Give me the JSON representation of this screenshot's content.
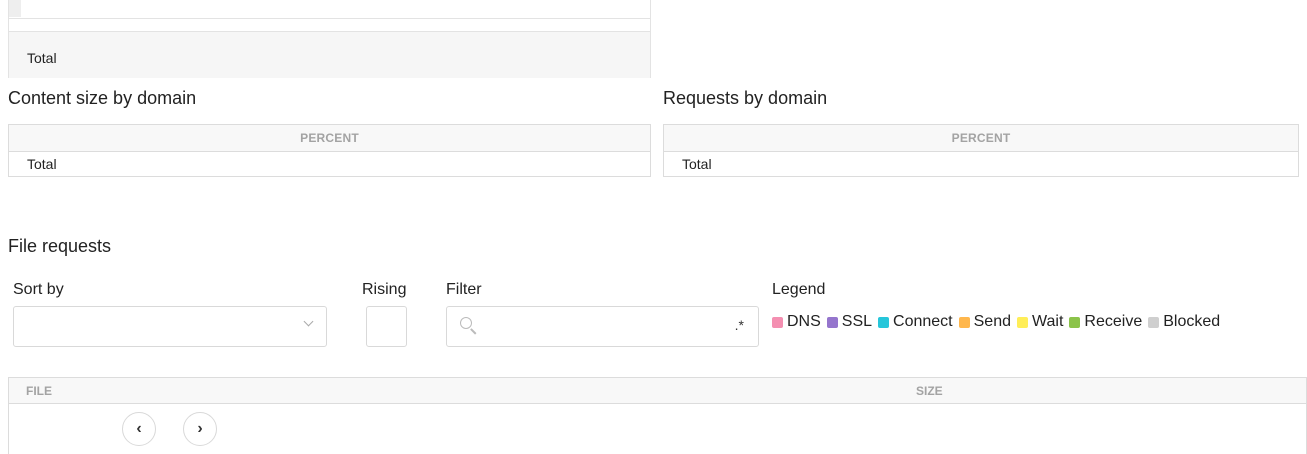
{
  "top_table": {
    "total_label": "Total"
  },
  "content_size": {
    "title": "Content size by domain",
    "column_header": "PERCENT",
    "total_label": "Total"
  },
  "requests": {
    "title": "Requests by domain",
    "column_header": "PERCENT",
    "total_label": "Total"
  },
  "file_requests": {
    "title": "File requests",
    "sort_by_label": "Sort by",
    "sort_by_value": "",
    "rising_label": "Rising",
    "filter_label": "Filter",
    "filter_value": "",
    "filter_regex_glyph": ".*",
    "legend_label": "Legend",
    "legend_items": [
      {
        "label": "DNS",
        "color": "#f48fb1"
      },
      {
        "label": "SSL",
        "color": "#9575cd"
      },
      {
        "label": "Connect",
        "color": "#26c6da"
      },
      {
        "label": "Send",
        "color": "#ffb74d"
      },
      {
        "label": "Wait",
        "color": "#ffee58"
      },
      {
        "label": "Receive",
        "color": "#8bc34a"
      },
      {
        "label": "Blocked",
        "color": "#cfcfcf"
      }
    ],
    "table": {
      "columns": [
        "FILE",
        "SIZE"
      ]
    },
    "pager": {
      "prev_glyph": "‹",
      "next_glyph": "›"
    }
  }
}
